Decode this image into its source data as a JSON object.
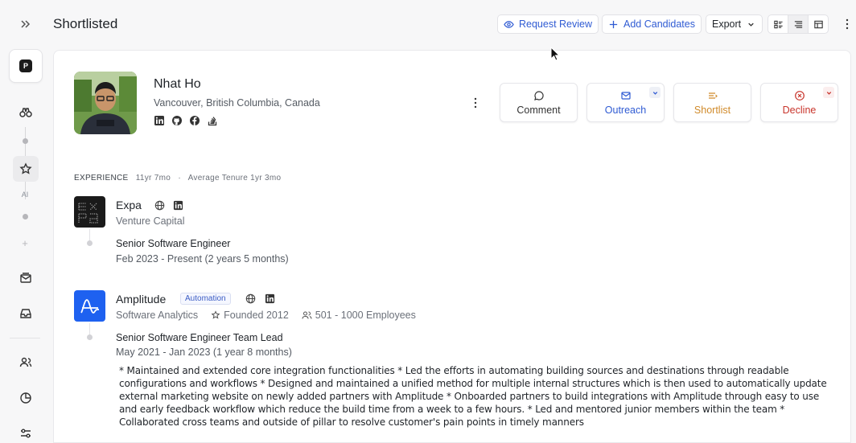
{
  "header": {
    "title": "Shortlisted",
    "request_review": "Request Review",
    "add_candidates": "Add Candidates",
    "export": "Export"
  },
  "rail": {
    "logo_letter": "P",
    "ai_label": "AI"
  },
  "profile": {
    "name": "Nhat Ho",
    "location": "Vancouver, British Columbia, Canada",
    "socials": [
      "linkedin-icon",
      "github-icon",
      "facebook-icon",
      "stackoverflow-icon"
    ]
  },
  "actions": {
    "comment": "Comment",
    "outreach": "Outreach",
    "shortlist": "Shortlist",
    "decline": "Decline"
  },
  "colors": {
    "blue": "#2f5bd3",
    "shortlist": "#d08a2a",
    "decline": "#c8342b"
  },
  "experience": {
    "label": "EXPERIENCE",
    "total": "11yr 7mo",
    "separator": "·",
    "avg_tenure": "Average Tenure 1yr 3mo",
    "companies": [
      {
        "name": "Expa",
        "industry": "Venture Capital",
        "role": "Senior Software Engineer",
        "period": "Feb 2023 - Present (2 years 5 months)"
      },
      {
        "name": "Amplitude",
        "badge": "Automation",
        "industry": "Software Analytics",
        "founded": "Founded 2012",
        "employees": "501 - 1000 Employees",
        "role": "Senior Software Engineer Team Lead",
        "period": "May 2021 - Jan 2023 (1 year 8 months)",
        "description": "* Maintained and extended core integration functionalities * Led the efforts in automating building sources and destinations through readable configurations and workflows * Designed and maintained a unified method for multiple internal structures which is then used to automatically update external marketing website on newly added partners with Amplitude * Onboarded partners to build integrations with Amplitude through easy to use and early feedback workflow which reduce the build time from a week to a few hours. * Led and mentored junior members within the team * Collaborated cross teams and outside of pillar to resolve customer's pain points in timely manners"
      }
    ]
  }
}
